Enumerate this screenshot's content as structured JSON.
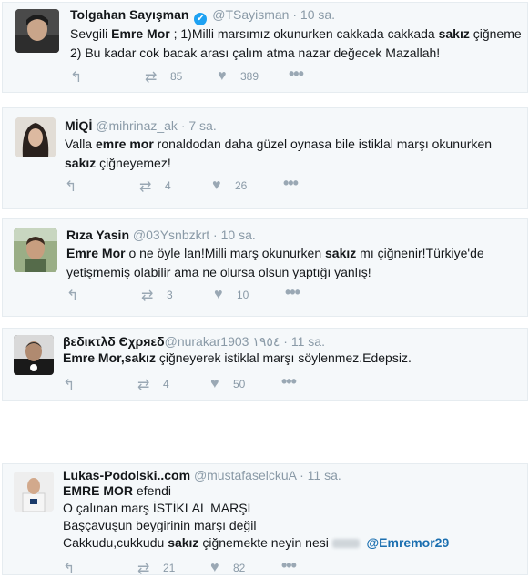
{
  "tweets": [
    {
      "name": "Tolgahan Sayışman",
      "handle": "@TSayisman",
      "time": "10 sa.",
      "lines": [
        [
          "Sevgili ",
          "Emre Mor",
          " ; 1)Milli marsımız okunurken cakkada cakkada ",
          "sakız",
          " çiğneme"
        ],
        [
          "2) Bu kadar cok bacak arası çalım atma  nazar değecek Mazallah!"
        ]
      ],
      "retweets": "85",
      "likes": "389"
    },
    {
      "name": "MİQİ",
      "handle": "@mihrinaz_ak",
      "time": "7 sa.",
      "lines": [
        [
          "Valla ",
          "emre mor",
          " ronaldodan daha güzel oynasa bile istiklal marşı okunurken"
        ],
        [
          "",
          "sakız",
          " çiğneyemez!"
        ]
      ],
      "retweets": "4",
      "likes": "26"
    },
    {
      "name": "Rıza Yasin",
      "handle": "@03Ysnbzkrt",
      "time": "10 sa.",
      "lines": [
        [
          "",
          "Emre Mor",
          " o ne öyle lan!Milli marş okunurken ",
          "sakız",
          " mı çiğnenir!Türkiye'de"
        ],
        [
          "yetişmemiş olabilir ama ne olursa olsun yaptığı yanlış!"
        ]
      ],
      "retweets": "3",
      "likes": "10"
    },
    {
      "name": "βεδικτλδ Єχρяεδ",
      "handle": "@nurakar1903 ١٩٥٤",
      "time": "11 sa.",
      "lines": [
        [
          "",
          "Emre Mor",
          ",",
          "sakız",
          " çiğneyerek istiklal marşı söylenmez.Edepsiz."
        ]
      ],
      "retweets": "4",
      "likes": "50"
    },
    {
      "name": "Lukas-Podolski..com",
      "handle": "@mustafaselckuA",
      "time": "11 sa.",
      "lines": [
        [
          "",
          "EMRE MOR",
          " efendi"
        ],
        [
          "O çalınan marş İSTİKLAL MARŞI"
        ],
        [
          "Başçavuşun beygirinin marşı değil"
        ],
        [
          "Cakkudu,cukkudu ",
          "sakız",
          " çiğnemekte neyin nesi "
        ]
      ],
      "mention": "@Emremor29",
      "retweets": "21",
      "likes": "82"
    }
  ],
  "icons": {
    "reply": "reply-icon",
    "retweet": "retweet-icon",
    "like": "heart-icon",
    "more": "more-icon",
    "verified": "verified-badge-icon"
  },
  "separator": "·"
}
